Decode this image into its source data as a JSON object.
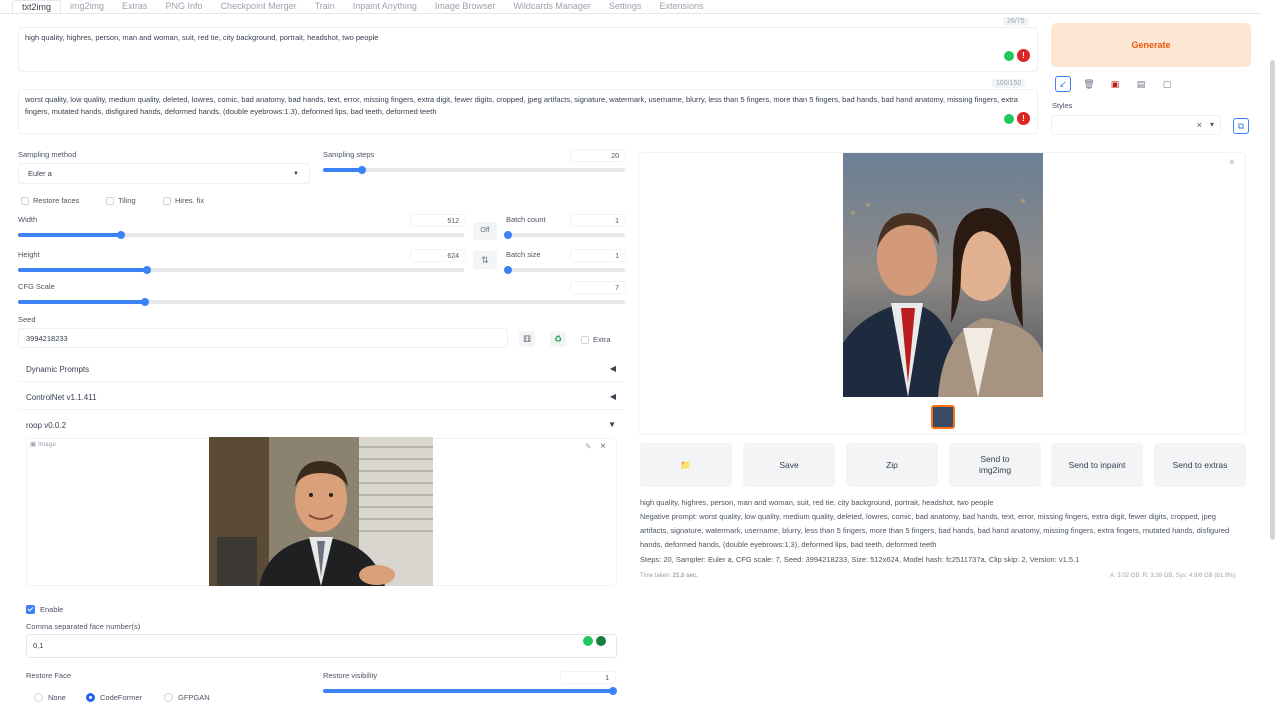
{
  "tabs": [
    "txt2img",
    "img2img",
    "Extras",
    "PNG Info",
    "Checkpoint Merger",
    "Train",
    "Inpaint Anything",
    "Image Browser",
    "Wildcards Manager",
    "Settings",
    "Extensions"
  ],
  "prompt": {
    "text": "high quality, highres, person, man and woman, suit, red tie, city background, portrait, headshot, two people",
    "counter": "26/75"
  },
  "negative": {
    "text": "worst quality, low quality, medium quality, deleted, lowres, comic, bad anatomy, bad hands, text, error, missing fingers, extra digit, fewer digits, cropped, jpeg artifacts, signature, watermark, username, blurry, less than 5 fingers, more than 5 fingers, bad hands, bad hand anatomy, missing fingers, extra fingers, mutated hands, disfigured hands, deformed hands, (double eyebrows:1.3), deformed lips, bad teeth, deformed teeth",
    "counter": "100/150"
  },
  "badge": "!",
  "generate": {
    "label": "Generate"
  },
  "styles": {
    "label": "Styles",
    "clear": "×",
    "arrow": "▾"
  },
  "sampling": {
    "method_label": "Sampling method",
    "method_value": "Euler a",
    "steps_label": "Sampling steps",
    "steps_value": "20",
    "steps_fraction": 0.13
  },
  "options": {
    "restore_faces": "Restore faces",
    "tiling": "Tiling",
    "hires_fix": "Hires. fix"
  },
  "width": {
    "label": "Width",
    "value": "512",
    "fraction": 0.23
  },
  "height": {
    "label": "Height",
    "value": "624",
    "fraction": 0.29
  },
  "swap": {
    "off": "Off",
    "icon": "⇅"
  },
  "batch_count": {
    "label": "Batch count",
    "value": "1",
    "fraction": 0.0
  },
  "batch_size": {
    "label": "Batch size",
    "value": "1",
    "fraction": 0.0
  },
  "cfg": {
    "label": "CFG Scale",
    "value": "7",
    "fraction": 0.21
  },
  "seed": {
    "label": "Seed",
    "value": "3994218233",
    "extra": "Extra"
  },
  "accordions": {
    "dynamic_prompts": "Dynamic Prompts",
    "controlnet": "ControlNet v1.1.411",
    "roop": "roop v0.0.2",
    "collapsed_arrow": "◀",
    "open_arrow": "▼"
  },
  "roop": {
    "image_label": "Image",
    "enable": "Enable",
    "face_numbers_label": "Comma separated face number(s)",
    "face_numbers_value": "0,1",
    "restore_face_label": "Restore Face",
    "restore_options": [
      "None",
      "CodeFormer",
      "GFPGAN"
    ],
    "restore_selected": "CodeFormer",
    "visibility_label": "Restore visibility",
    "visibility_value": "1",
    "visibility_fraction": 1.0
  },
  "output": {
    "buttons": {
      "folder": "📁",
      "save": "Save",
      "zip": "Zip",
      "send_img2img": "Send to img2img",
      "send_inpaint": "Send to inpaint",
      "send_extras": "Send to extras"
    },
    "info_prompt": "high quality, highres, person, man and woman, suit, red tie, city background, portrait, headshot, two people",
    "info_negative": "Negative prompt: worst quality, low quality, medium quality, deleted, lowres, comic, bad anatomy, bad hands, text, error, missing fingers, extra digit, fewer digits, cropped, jpeg artifacts, signature, watermark, username, blurry, less than 5 fingers, more than 5 fingers, bad hands, bad hand anatomy, missing fingers, extra fingers, mutated hands, disfigured hands, deformed hands, (double eyebrows:1.3), deformed lips, bad teeth, deformed teeth",
    "info_params": "Steps: 20, Sampler: Euler a, CFG scale: 7, Seed: 3994218233, Size: 512x624, Model hash: fc2511737a, Clip skip: 2, Version: v1.5.1",
    "time_taken_label": "Time taken:",
    "time_taken": "21.0 sec.",
    "vram": "A: 3.02 GB, R: 3.38 GB, Sys: 4.9/8 GB (61.8%)",
    "close": "×"
  },
  "colors": {
    "accent": "#3b82f6",
    "generate_bg": "#fde6d2",
    "generate_text": "#ea580c"
  }
}
